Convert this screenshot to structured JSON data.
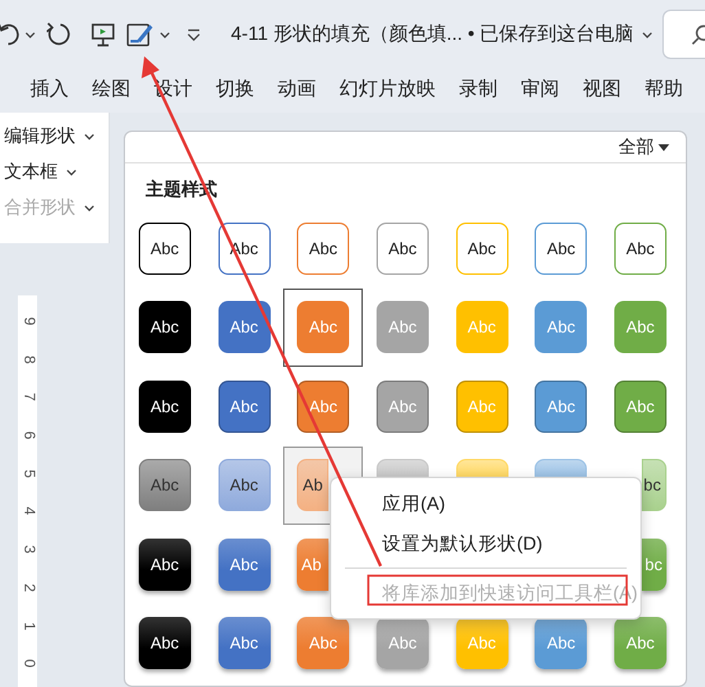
{
  "title_bar": {
    "title": "4-11 形状的填充（颜色填... • 已保存到这台电脑"
  },
  "tabs": [
    {
      "label": "插入",
      "selected": false
    },
    {
      "label": "绘图",
      "selected": false
    },
    {
      "label": "设计",
      "selected": false
    },
    {
      "label": "切换",
      "selected": false
    },
    {
      "label": "动画",
      "selected": false
    },
    {
      "label": "幻灯片放映",
      "selected": false
    },
    {
      "label": "录制",
      "selected": false
    },
    {
      "label": "审阅",
      "selected": false
    },
    {
      "label": "视图",
      "selected": false
    },
    {
      "label": "帮助",
      "selected": false
    }
  ],
  "ribbon": {
    "items": [
      {
        "label": "编辑形状",
        "disabled": false
      },
      {
        "label": "文本框",
        "disabled": false
      },
      {
        "label": "合并形状",
        "disabled": true
      }
    ]
  },
  "ruler": {
    "labels": [
      "9",
      "8",
      "7",
      "6",
      "5",
      "4",
      "3",
      "2",
      "1",
      "0"
    ]
  },
  "gallery": {
    "filter": "全部",
    "heading": "主题样式",
    "rows": [
      {
        "kind": "outline",
        "tiles": [
          {
            "label": "Abc",
            "color": "#000000",
            "selected": false,
            "focused": false
          },
          {
            "label": "Abc",
            "color": "#4472c4",
            "selected": false,
            "focused": false
          },
          {
            "label": "Abc",
            "color": "#ed7d31",
            "selected": false,
            "focused": false
          },
          {
            "label": "Abc",
            "color": "#a5a5a5",
            "selected": false,
            "focused": false
          },
          {
            "label": "Abc",
            "color": "#ffc000",
            "selected": false,
            "focused": false
          },
          {
            "label": "Abc",
            "color": "#5b9bd5",
            "selected": false,
            "focused": false
          },
          {
            "label": "Abc",
            "color": "#70ad47",
            "selected": false,
            "focused": false
          }
        ]
      },
      {
        "kind": "solid",
        "tiles": [
          {
            "label": "Abc",
            "color": "#000000",
            "selected": false,
            "focused": false
          },
          {
            "label": "Abc",
            "color": "#4472c4",
            "selected": false,
            "focused": false
          },
          {
            "label": "Abc",
            "color": "#ed7d31",
            "selected": true,
            "focused": false
          },
          {
            "label": "Abc",
            "color": "#a5a5a5",
            "selected": false,
            "focused": false
          },
          {
            "label": "Abc",
            "color": "#ffc000",
            "selected": false,
            "focused": false
          },
          {
            "label": "Abc",
            "color": "#5b9bd5",
            "selected": false,
            "focused": false
          },
          {
            "label": "Abc",
            "color": "#70ad47",
            "selected": false,
            "focused": false
          }
        ]
      },
      {
        "kind": "subtle",
        "tiles": [
          {
            "label": "Abc",
            "color": "#000000",
            "selected": false,
            "focused": false
          },
          {
            "label": "Abc",
            "color": "#4472c4",
            "selected": false,
            "focused": false
          },
          {
            "label": "Abc",
            "color": "#ed7d31",
            "selected": false,
            "focused": false
          },
          {
            "label": "Abc",
            "color": "#a5a5a5",
            "selected": false,
            "focused": false
          },
          {
            "label": "Abc",
            "color": "#ffc000",
            "selected": false,
            "focused": false
          },
          {
            "label": "Abc",
            "color": "#5b9bd5",
            "selected": false,
            "focused": false
          },
          {
            "label": "Abc",
            "color": "#70ad47",
            "selected": false,
            "focused": false
          }
        ]
      },
      {
        "kind": "light",
        "tiles": [
          {
            "label": "Abc",
            "color": "#7f7f7f",
            "selected": false,
            "focused": false
          },
          {
            "label": "Abc",
            "color": "#8faadc",
            "selected": false,
            "focused": false
          },
          {
            "label": "Ab",
            "color": "#f4b183",
            "selected": false,
            "focused": true
          },
          {
            "color": "#c9c9c9",
            "selected": false,
            "focused": false
          },
          {
            "color": "#ffd966",
            "selected": false,
            "focused": false
          },
          {
            "color": "#9dc3e6",
            "selected": false,
            "focused": false
          },
          {
            "label": "bc",
            "color": "#a9d18e",
            "selected": false,
            "focused": false
          }
        ]
      },
      {
        "kind": "gradient",
        "tiles": [
          {
            "label": "Abc",
            "color": "#000000",
            "selected": false,
            "focused": false
          },
          {
            "label": "Abc",
            "color": "#4472c4",
            "selected": false,
            "focused": false
          },
          {
            "label": "Ab",
            "color": "#ed7d31",
            "selected": false,
            "focused": false
          },
          {
            "label": "bc",
            "color": "#70ad47",
            "selected": false,
            "focused": false
          }
        ]
      },
      {
        "kind": "gradient",
        "tiles": [
          {
            "label": "Abc",
            "color": "#000000",
            "selected": false,
            "focused": false
          },
          {
            "label": "Abc",
            "color": "#4472c4",
            "selected": false,
            "focused": false
          },
          {
            "label": "Abc",
            "color": "#ed7d31",
            "selected": false,
            "focused": false
          },
          {
            "label": "Abc",
            "color": "#a5a5a5",
            "selected": false,
            "focused": false
          },
          {
            "label": "Abc",
            "color": "#ffc000",
            "selected": false,
            "focused": false
          },
          {
            "label": "Abc",
            "color": "#5b9bd5",
            "selected": false,
            "focused": false
          },
          {
            "label": "Abc",
            "color": "#70ad47",
            "selected": false,
            "focused": false
          }
        ]
      }
    ]
  },
  "context_menu": {
    "items": [
      {
        "label": "应用(A)",
        "disabled": false
      },
      {
        "label": "设置为默认形状(D)",
        "disabled": false
      },
      {
        "label": "将库添加到快速访问工具栏(A)",
        "disabled": true
      }
    ]
  }
}
